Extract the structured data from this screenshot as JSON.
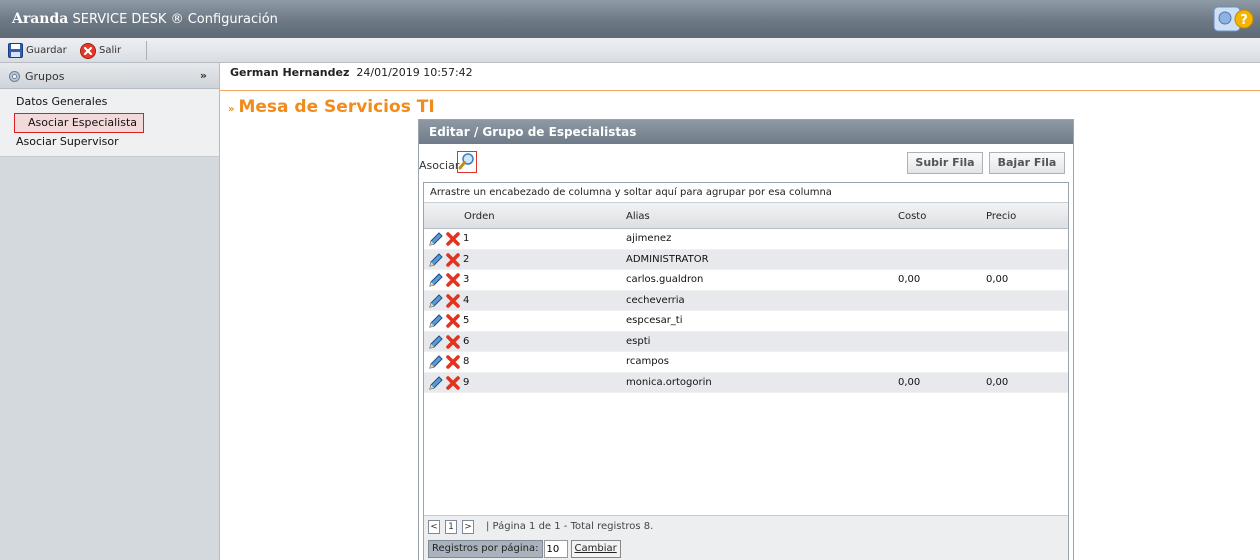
{
  "titlebar": {
    "brand_bold": "Aranda",
    "brand_rest": " SERVICE DESK ® Configuración"
  },
  "toolbar": {
    "save_label": "Guardar",
    "exit_label": "Salir"
  },
  "sidebar": {
    "header": "Grupos",
    "items": [
      {
        "label": "Datos Generales"
      },
      {
        "label": "Asociar Especialista"
      },
      {
        "label": "Asociar Supervisor"
      }
    ]
  },
  "header": {
    "user": "German Hernandez",
    "datetime": "24/01/2019 10:57:42"
  },
  "page_title": "Mesa de Servicios TI",
  "panel": {
    "title": "Editar / Grupo de Especialistas",
    "asociar_label": "Asociar",
    "up_label": "Subir Fila",
    "down_label": "Bajar Fila",
    "group_hint": "Arrastre un encabezado de columna y soltar aquí para agrupar por esa columna",
    "columns": {
      "orden": "Orden",
      "alias": "Alias",
      "costo": "Costo",
      "precio": "Precio"
    },
    "rows": [
      {
        "orden": "1",
        "alias": "ajimenez",
        "costo": "",
        "precio": ""
      },
      {
        "orden": "2",
        "alias": "ADMINISTRATOR",
        "costo": "",
        "precio": ""
      },
      {
        "orden": "3",
        "alias": "carlos.gualdron",
        "costo": "0,00",
        "precio": "0,00"
      },
      {
        "orden": "4",
        "alias": "cecheverria",
        "costo": "",
        "precio": ""
      },
      {
        "orden": "5",
        "alias": "espcesar_ti",
        "costo": "",
        "precio": ""
      },
      {
        "orden": "6",
        "alias": "espti",
        "costo": "",
        "precio": ""
      },
      {
        "orden": "8",
        "alias": "rcampos",
        "costo": "",
        "precio": ""
      },
      {
        "orden": "9",
        "alias": "monica.ortogorin",
        "costo": "0,00",
        "precio": "0,00"
      }
    ],
    "pager": {
      "prev": "<",
      "page": "1",
      "next": ">",
      "info": "|  Página 1 de 1 - Total registros 8.",
      "rpp_label": "Registros por página:",
      "rpp_value": "10",
      "change_label": "Cambiar"
    }
  }
}
